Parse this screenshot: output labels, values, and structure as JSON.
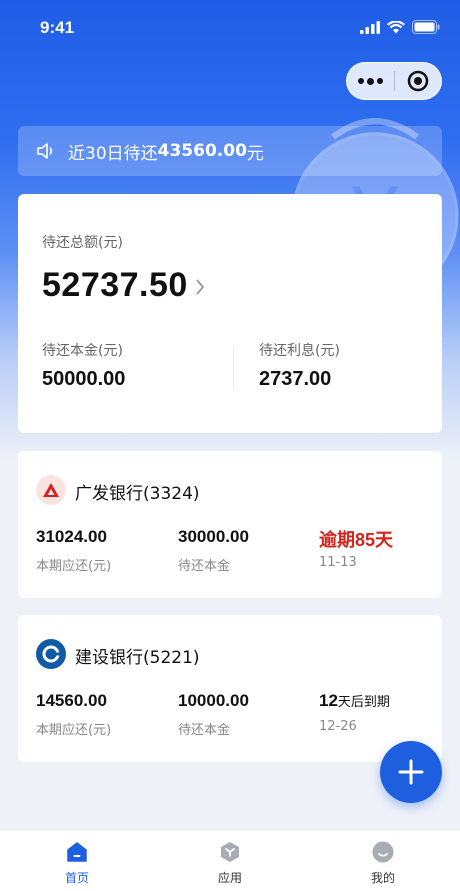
{
  "status_bar": {
    "time": "9:41"
  },
  "notice": {
    "prefix": "近30日待还",
    "amount": "43560.00",
    "suffix": "元"
  },
  "summary": {
    "total_label": "待还总额(元)",
    "total_value": "52737.50",
    "principal_label": "待还本金(元)",
    "principal_value": "50000.00",
    "interest_label": "待还利息(元)",
    "interest_value": "2737.00"
  },
  "banks": [
    {
      "name": "广发银行(3324)",
      "logo_color": "#d4231b",
      "current_due": "31024.00",
      "current_due_label": "本期应还(元)",
      "principal": "30000.00",
      "principal_label": "待还本金",
      "status_text": "逾期85天",
      "status_date": "11-13"
    },
    {
      "name": "建设银行(5221)",
      "logo_color": "#0f5ba8",
      "current_due": "14560.00",
      "current_due_label": "本期应还(元)",
      "principal": "10000.00",
      "principal_label": "待还本金",
      "status_num": "12",
      "status_suffix": "天后到期",
      "status_date": "12-26"
    }
  ],
  "tabs": [
    {
      "label": "首页",
      "icon": "home-icon",
      "active": true
    },
    {
      "label": "应用",
      "icon": "apps-icon",
      "active": false
    },
    {
      "label": "我的",
      "icon": "profile-icon",
      "active": false
    }
  ],
  "colors": {
    "primary": "#1e5fe0",
    "overdue": "#d4231b"
  }
}
